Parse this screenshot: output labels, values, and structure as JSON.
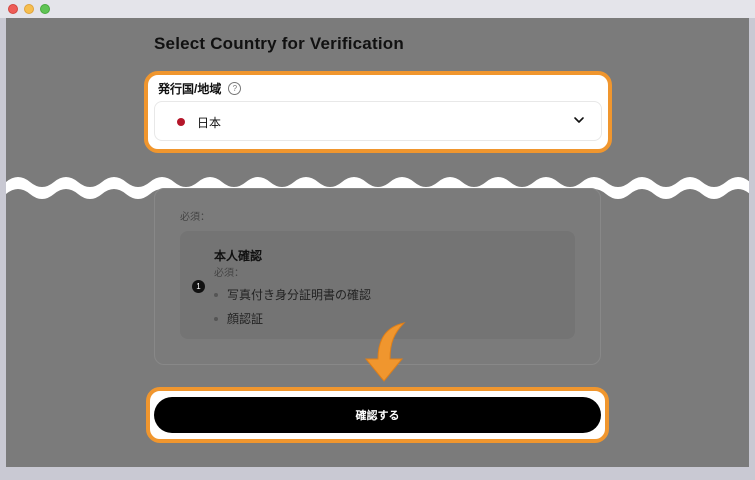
{
  "window": {
    "controls": [
      "close",
      "minimize",
      "maximize"
    ]
  },
  "page": {
    "title": "Select Country for Verification"
  },
  "country_field": {
    "label": "発行国/地域",
    "help_icon": "?",
    "selected_value": "日本",
    "flag_color": "#b5162a"
  },
  "requirements": {
    "required_label": "必須：",
    "steps": [
      {
        "number": "1",
        "title": "本人確認",
        "required_label": "必須：",
        "items": [
          "写真付き身分証明書の確認",
          "顔認証"
        ]
      }
    ]
  },
  "actions": {
    "confirm_label": "確認する"
  },
  "colors": {
    "highlight": "#f0962e",
    "overlay": "#7b7b7b",
    "button": "#000000"
  }
}
